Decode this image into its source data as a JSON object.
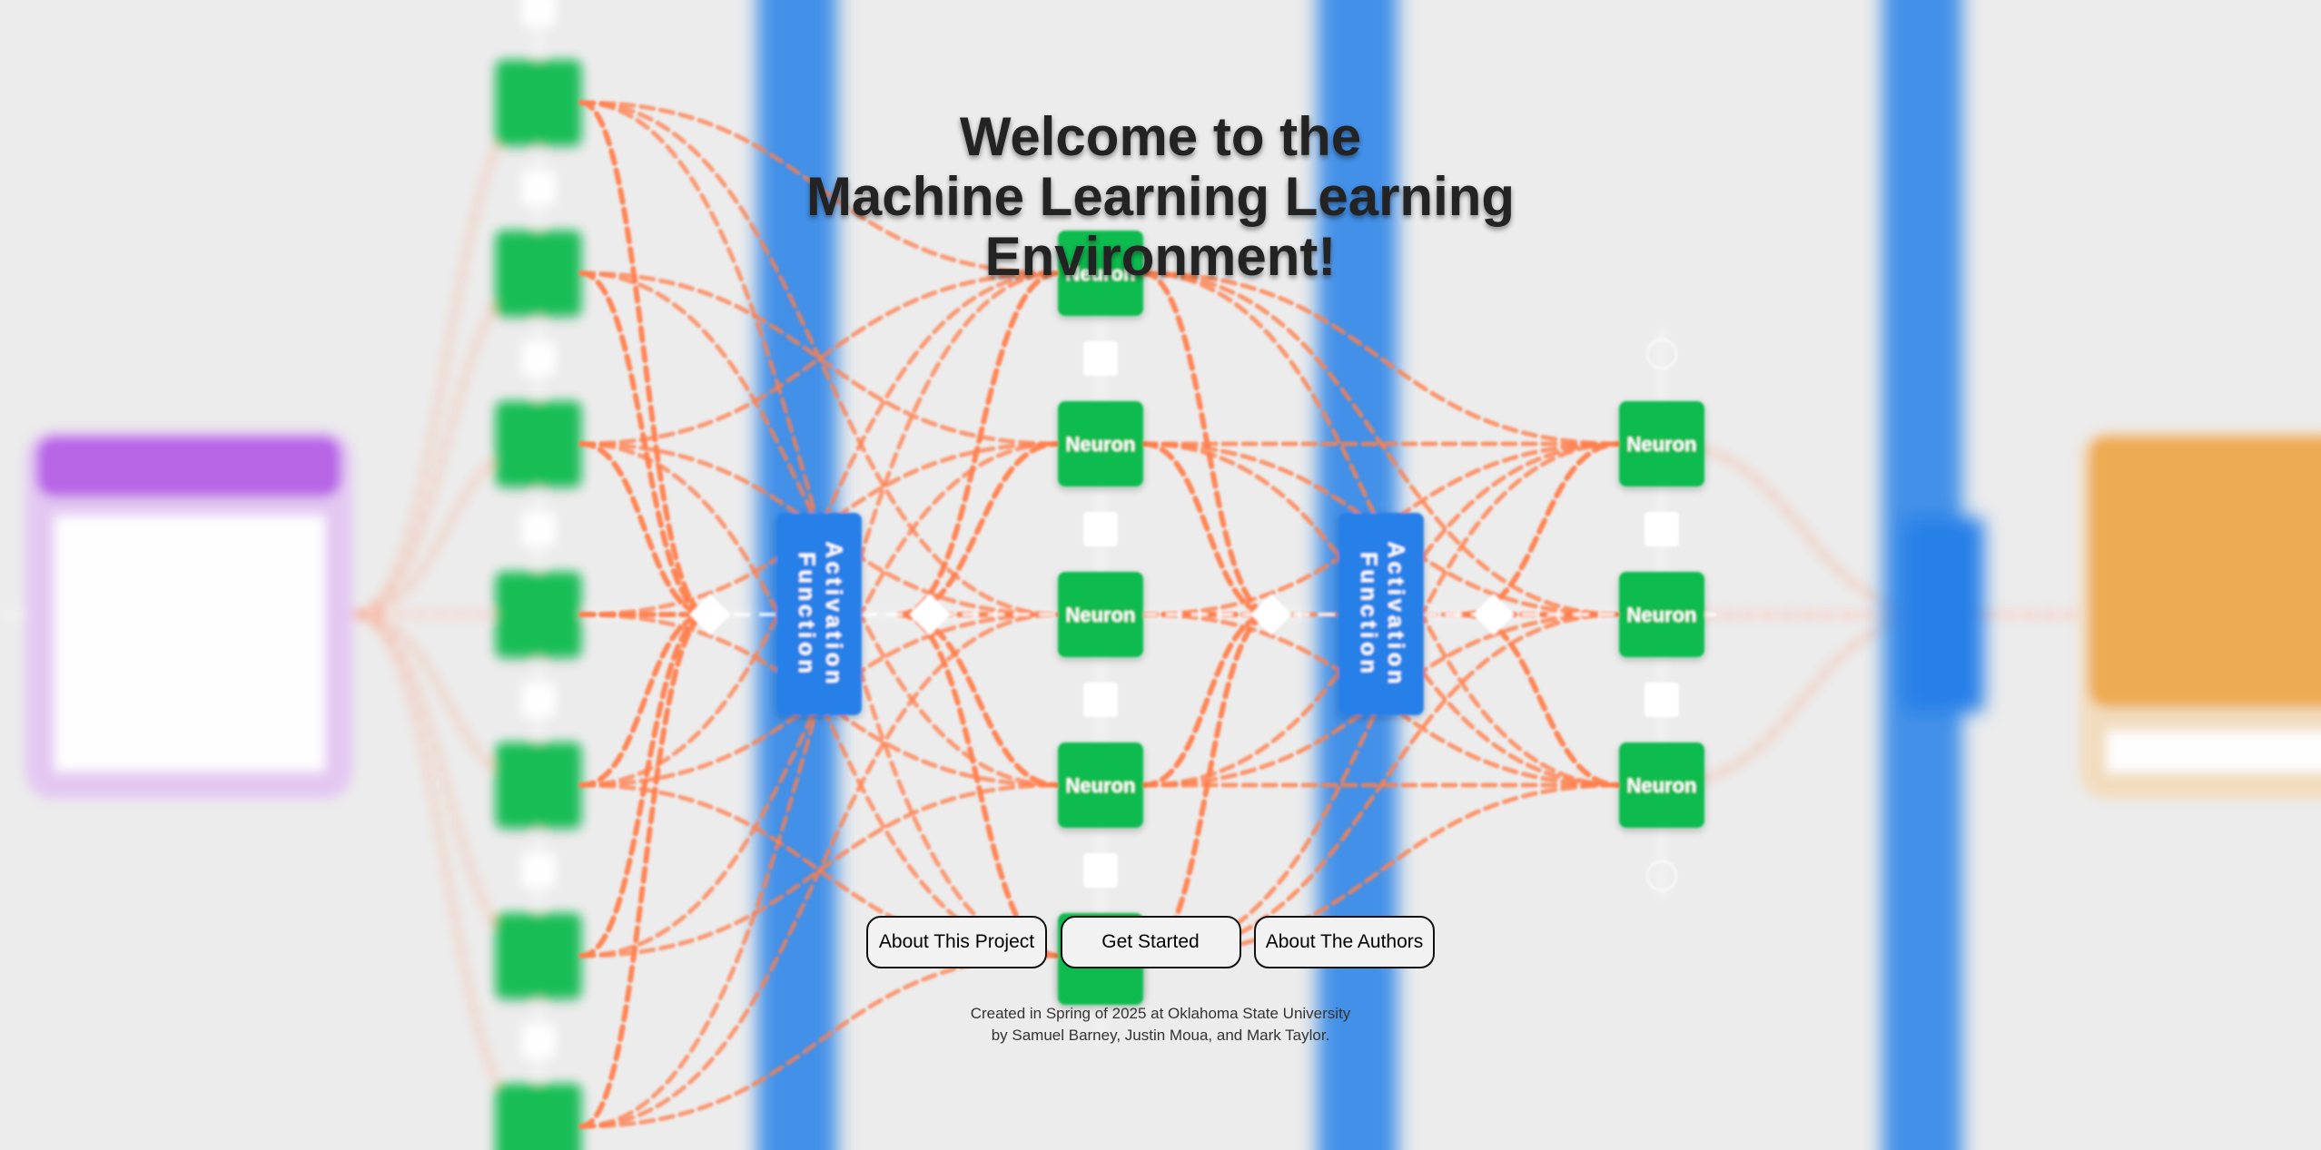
{
  "hero": {
    "title_lines": [
      "Welcome to the",
      "Machine Learning Learning",
      "Environment!"
    ]
  },
  "buttons": {
    "about_project": "About This Project",
    "get_started": "Get Started",
    "about_authors": "About The Authors"
  },
  "credits": {
    "line1": "Created in Spring of 2025 at Oklahoma State University",
    "line2": "by Samuel Barney, Justin Moua, and Mark Taylor."
  },
  "background": {
    "neuron_label": "Neuron",
    "activation_label_line1": "Activation",
    "activation_label_line2": "Function",
    "colors": {
      "neuron": "#0ebb4f",
      "activation": "#2580e8",
      "connection": "#ff7f4d",
      "input_panel": "#b65ee6",
      "output_panel": "#eea94b",
      "page": "#ececec"
    }
  }
}
